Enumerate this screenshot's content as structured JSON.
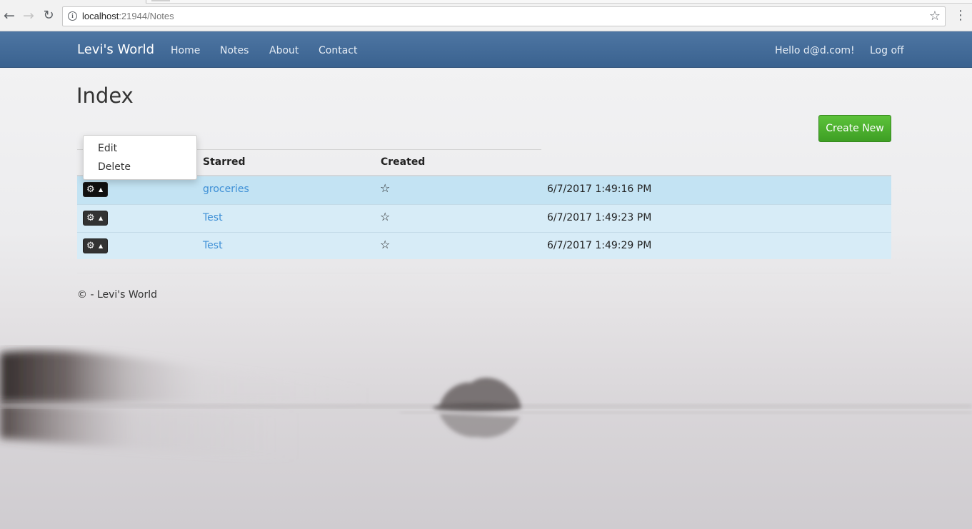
{
  "browser": {
    "url_host": "localhost",
    "url_path": ":21944/Notes",
    "icons": [
      "back-arrow-icon",
      "forward-arrow-icon",
      "reload-icon",
      "info-icon",
      "bookmark-star-icon",
      "more-vert-icon"
    ]
  },
  "navbar": {
    "brand": "Levi's World",
    "links": [
      "Home",
      "Notes",
      "About",
      "Contact"
    ],
    "hello": "Hello d@d.com!",
    "logoff": "Log off",
    "color": "#3f6895"
  },
  "page": {
    "title": "Index",
    "create_new": "Create New"
  },
  "table": {
    "headers": [
      "Starred",
      "Created"
    ],
    "rows": [
      {
        "title": "groceries",
        "starred": "☆",
        "created": "6/7/2017 1:49:16 PM"
      },
      {
        "title": "Test",
        "starred": "☆",
        "created": "6/7/2017 1:49:23 PM"
      },
      {
        "title": "Test",
        "starred": "☆",
        "created": "6/7/2017 1:49:29 PM"
      }
    ]
  },
  "dropdown": {
    "open": true,
    "items": [
      "Edit",
      "Delete"
    ]
  },
  "footer": {
    "text": "© - Levi's World"
  },
  "colors": {
    "accent_green": "#4caf2c",
    "link_blue": "#3d8fd6",
    "row_highlight": "#c3e3f3",
    "row": "#d7ecf7"
  }
}
